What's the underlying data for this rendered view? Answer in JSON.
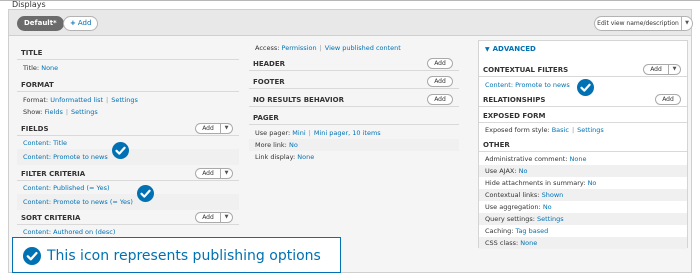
{
  "header": {
    "title": "Displays"
  },
  "topbar": {
    "default_tab": "Default*",
    "add_label": "Add",
    "edit_label": "Edit view name/description",
    "drop_glyph": "▼"
  },
  "col1": {
    "title": {
      "head": "TITLE",
      "label": "Title:",
      "value": "None"
    },
    "format": {
      "head": "FORMAT",
      "format_label": "Format:",
      "format_value": "Unformatted list",
      "format_settings": "Settings",
      "show_label": "Show:",
      "show_value": "Fields",
      "show_settings": "Settings"
    },
    "fields": {
      "head": "FIELDS",
      "add": "Add",
      "items": [
        "Content: Title",
        "Content: Promote to news"
      ]
    },
    "filter": {
      "head": "FILTER CRITERIA",
      "add": "Add",
      "items": [
        "Content: Published (= Yes)",
        "Content: Promote to news (= Yes)"
      ]
    },
    "sort": {
      "head": "SORT CRITERIA",
      "add": "Add",
      "items": [
        "Content: Authored on (desc)"
      ]
    }
  },
  "col2": {
    "access_label": "Access:",
    "access_value": "Permission",
    "access_link": "View published content",
    "header": {
      "head": "HEADER",
      "add": "Add"
    },
    "footer": {
      "head": "FOOTER",
      "add": "Add"
    },
    "noresults": {
      "head": "NO RESULTS BEHAVIOR",
      "add": "Add"
    },
    "pager": {
      "head": "PAGER",
      "use_label": "Use pager:",
      "use_value": "Mini",
      "use_link": "Mini pager, 10 items",
      "more_label": "More link:",
      "more_value": "No",
      "display_label": "Link display:",
      "display_value": "None"
    }
  },
  "col3": {
    "advanced": "ADVANCED",
    "contextual": {
      "head": "CONTEXTUAL FILTERS",
      "add": "Add",
      "item": "Content: Promote to news"
    },
    "relationships": {
      "head": "RELATIONSHIPS",
      "add": "Add"
    },
    "exposed": {
      "head": "EXPOSED FORM",
      "label": "Exposed form style:",
      "value": "Basic",
      "settings": "Settings"
    },
    "other": {
      "head": "OTHER",
      "rows": [
        {
          "label": "Administrative comment:",
          "value": "None"
        },
        {
          "label": "Use AJAX:",
          "value": "No"
        },
        {
          "label": "Hide attachments in summary:",
          "value": "No"
        },
        {
          "label": "Contextual links:",
          "value": "Shown"
        },
        {
          "label": "Use aggregation:",
          "value": "No"
        },
        {
          "label": "Query settings:",
          "value": "Settings"
        },
        {
          "label": "Caching:",
          "value": "Tag based"
        },
        {
          "label": "CSS class:",
          "value": "None"
        }
      ]
    }
  },
  "callout": {
    "text": "This icon represents publishing options"
  },
  "colors": {
    "accent": "#0071b3",
    "panel_bg": "#f5f5f5",
    "pill_default": "#6b6b6b"
  },
  "icons": [
    "check-circle-icon",
    "chevron-down-icon",
    "plus-icon"
  ]
}
